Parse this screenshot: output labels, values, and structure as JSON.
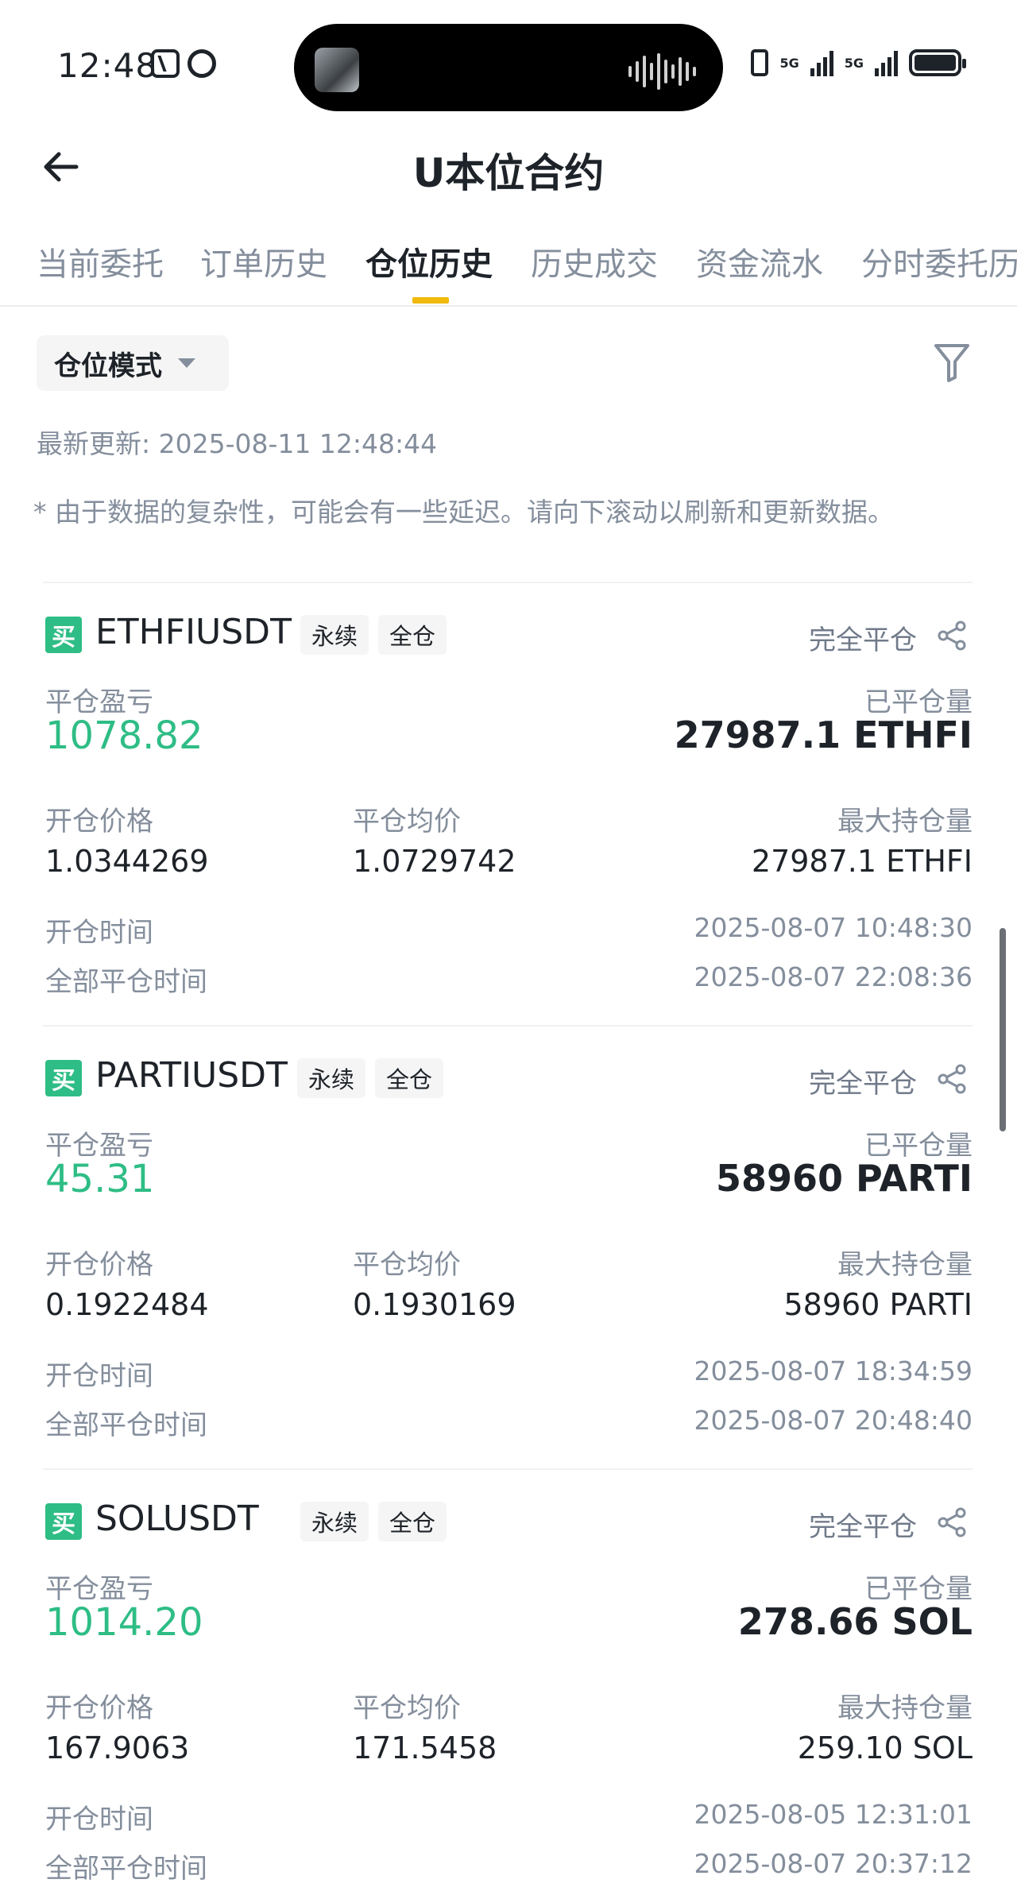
{
  "status_bar": {
    "time": "12:48",
    "network_1": "5G",
    "network_2": "5G"
  },
  "header": {
    "title": "U本位合约"
  },
  "tabs": [
    {
      "label": "当前委托"
    },
    {
      "label": "订单历史"
    },
    {
      "label": "仓位历史",
      "active": true
    },
    {
      "label": "历史成交"
    },
    {
      "label": "资金流水"
    },
    {
      "label": "分时委托历"
    }
  ],
  "filter": {
    "mode_label": "仓位模式"
  },
  "last_updated": "最新更新: 2025-08-11 12:48:44",
  "notice": "* 由于数据的复杂性，可能会有一些延迟。请向下滚动以刷新和更新数据。",
  "labels": {
    "buy_badge": "买",
    "perpetual_tag": "永续",
    "cross_tag": "全仓",
    "close_status": "完全平仓",
    "pnl": "平仓盈亏",
    "closed_qty": "已平仓量",
    "open_price": "开仓价格",
    "close_avg_price": "平仓均价",
    "max_hold": "最大持仓量",
    "open_time": "开仓时间",
    "full_close_time": "全部平仓时间"
  },
  "positions": [
    {
      "symbol": "ETHFIUSDT",
      "pnl": "1078.82",
      "closed_qty": "27987.1 ETHFI",
      "open_price": "1.0344269",
      "close_avg_price": "1.0729742",
      "max_hold": "27987.1 ETHFI",
      "open_time": "2025-08-07 10:48:30",
      "full_close_time": "2025-08-07 22:08:36"
    },
    {
      "symbol": "PARTIUSDT",
      "pnl": "45.31",
      "closed_qty": "58960 PARTI",
      "open_price": "0.1922484",
      "close_avg_price": "0.1930169",
      "max_hold": "58960 PARTI",
      "open_time": "2025-08-07 18:34:59",
      "full_close_time": "2025-08-07 20:48:40"
    },
    {
      "symbol": "SOLUSDT",
      "pnl": "1014.20",
      "closed_qty": "278.66 SOL",
      "open_price": "167.9063",
      "close_avg_price": "171.5458",
      "max_hold": "259.10 SOL",
      "open_time": "2025-08-05 12:31:01",
      "full_close_time": "2025-08-07 20:37:12"
    }
  ],
  "colors": {
    "profit": "#2ebd85",
    "accent": "#f0b90b",
    "muted": "#848e9c",
    "text": "#1e2329"
  }
}
